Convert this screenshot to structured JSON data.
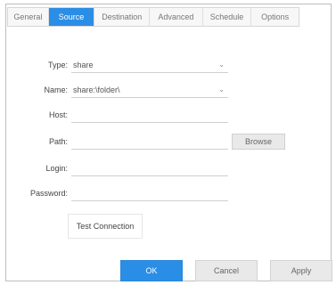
{
  "tabs": [
    {
      "label": "General"
    },
    {
      "label": "Source"
    },
    {
      "label": "Destination"
    },
    {
      "label": "Advanced"
    },
    {
      "label": "Schedule"
    },
    {
      "label": "Options"
    }
  ],
  "form": {
    "type": {
      "label": "Type:",
      "value": "share"
    },
    "name": {
      "label": "Name:",
      "value": "share:\\folder\\"
    },
    "host": {
      "label": "Host:",
      "value": ""
    },
    "path": {
      "label": "Path:",
      "value": "",
      "browse_label": "Browse"
    },
    "login": {
      "label": "Login:",
      "value": ""
    },
    "password": {
      "label": "Password:",
      "value": ""
    }
  },
  "test_connection_label": "Test Connection",
  "buttons": {
    "ok": "OK",
    "cancel": "Cancel",
    "apply": "Apply"
  },
  "colors": {
    "accent": "#2b8ee6"
  }
}
